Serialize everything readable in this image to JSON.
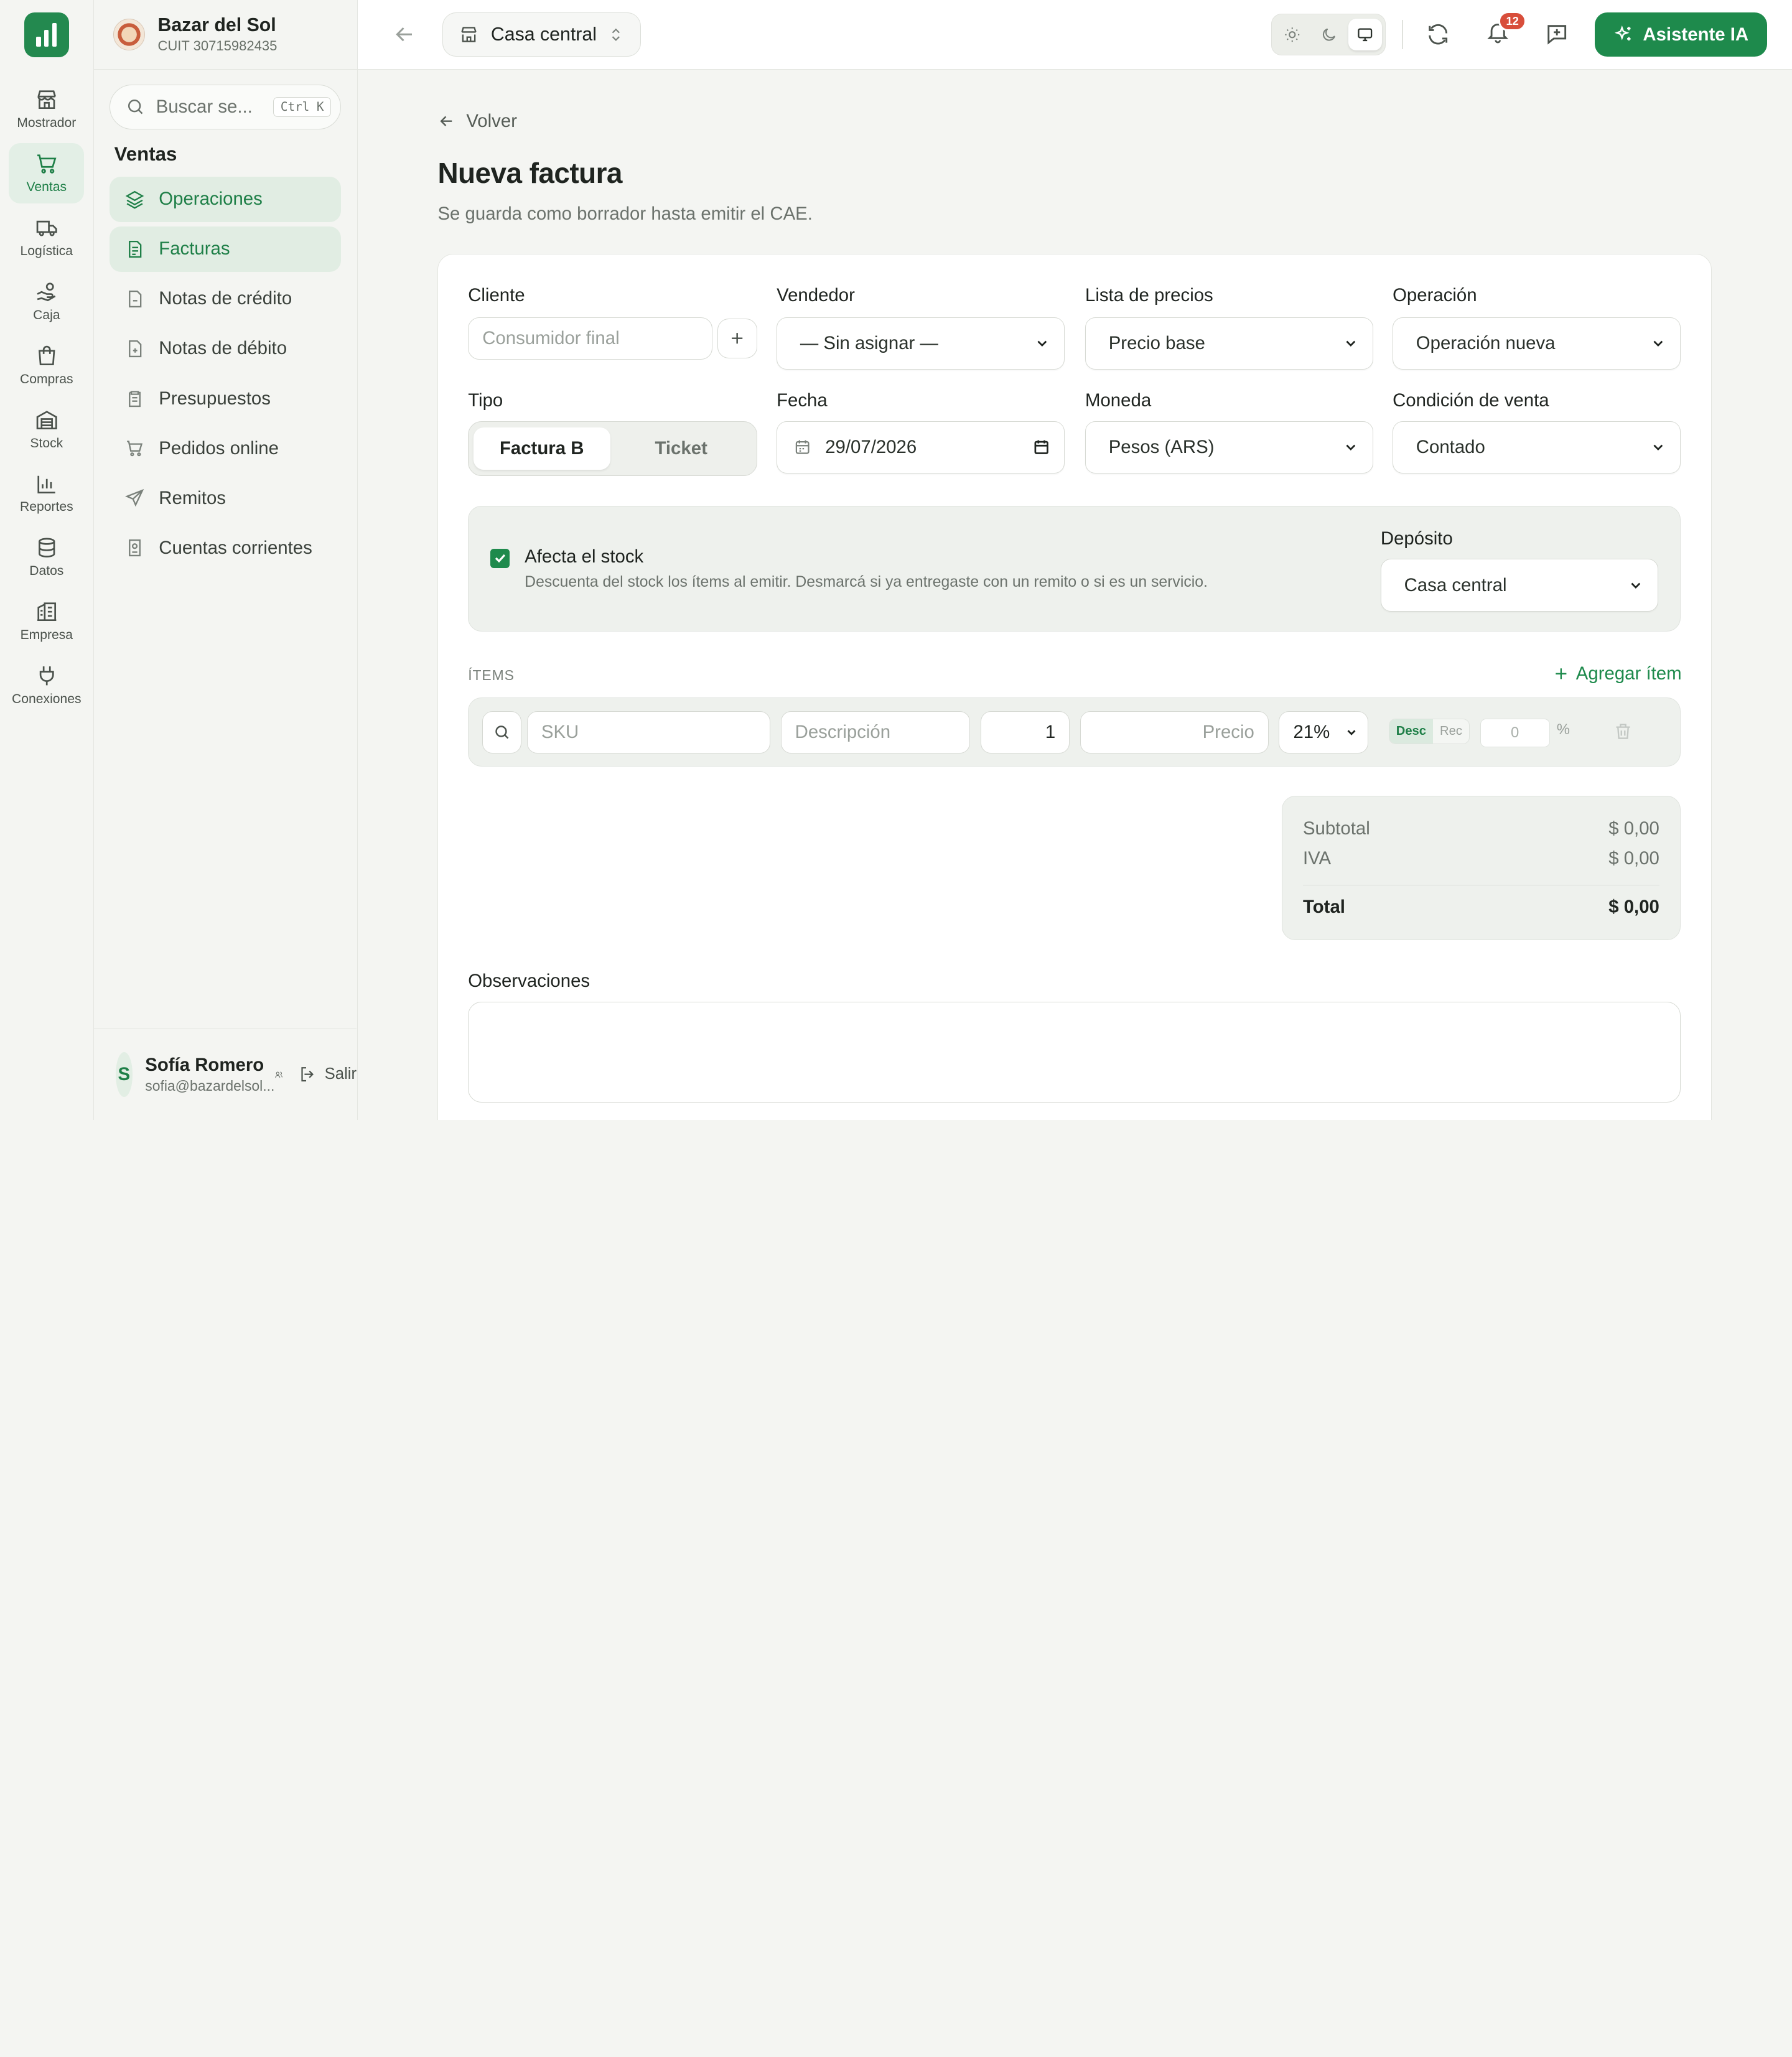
{
  "rail": {
    "items": [
      {
        "label": "Mostrador",
        "icon": "storefront-icon"
      },
      {
        "label": "Ventas",
        "icon": "cart-icon"
      },
      {
        "label": "Logística",
        "icon": "truck-icon"
      },
      {
        "label": "Caja",
        "icon": "cash-hand-icon"
      },
      {
        "label": "Compras",
        "icon": "shopping-bag-icon"
      },
      {
        "label": "Stock",
        "icon": "warehouse-icon"
      },
      {
        "label": "Reportes",
        "icon": "bar-chart-icon"
      },
      {
        "label": "Datos",
        "icon": "database-icon"
      },
      {
        "label": "Empresa",
        "icon": "building-icon"
      },
      {
        "label": "Conexiones",
        "icon": "plug-icon"
      }
    ],
    "active": "Ventas"
  },
  "org": {
    "name": "Bazar del Sol",
    "cuit": "CUIT 30715982435"
  },
  "search": {
    "placeholder": "Buscar se...",
    "shortcut": "Ctrl K"
  },
  "sidebar": {
    "section": "Ventas",
    "items": [
      {
        "label": "Operaciones",
        "icon": "layers-icon"
      },
      {
        "label": "Facturas",
        "icon": "invoice-icon"
      },
      {
        "label": "Notas de crédito",
        "icon": "file-minus-icon"
      },
      {
        "label": "Notas de débito",
        "icon": "file-plus-icon"
      },
      {
        "label": "Presupuestos",
        "icon": "clipboard-icon"
      },
      {
        "label": "Pedidos online",
        "icon": "cart-icon"
      },
      {
        "label": "Remitos",
        "icon": "send-icon"
      },
      {
        "label": "Cuentas corrientes",
        "icon": "account-book-icon"
      }
    ]
  },
  "user": {
    "initial": "S",
    "name": "Sofía Romero",
    "email": "sofia@bazardelsol...",
    "logout": "Salir"
  },
  "topbar": {
    "branch": "Casa central",
    "notifications": "12",
    "ai_button": "Asistente IA"
  },
  "page": {
    "back": "Volver",
    "title": "Nueva factura",
    "subtitle": "Se guarda como borrador hasta emitir el CAE."
  },
  "form": {
    "cliente_label": "Cliente",
    "cliente_placeholder": "Consumidor final",
    "vendedor_label": "Vendedor",
    "vendedor_value": "— Sin asignar —",
    "lista_label": "Lista de precios",
    "lista_value": "Precio base",
    "operacion_label": "Operación",
    "operacion_value": "Operación nueva",
    "tipo_label": "Tipo",
    "tipo_options": [
      "Factura B",
      "Ticket"
    ],
    "fecha_label": "Fecha",
    "fecha_value": "29/07/2026",
    "moneda_label": "Moneda",
    "moneda_value": "Pesos (ARS)",
    "condicion_label": "Condición de venta",
    "condicion_value": "Contado"
  },
  "stock": {
    "checked": true,
    "title": "Afecta el stock",
    "description": "Descuenta del stock los ítems al emitir. Desmarcá si ya entregaste con un remito o si es un servicio.",
    "deposito_label": "Depósito",
    "deposito_value": "Casa central"
  },
  "items": {
    "label": "ÍTEMS",
    "add": "Agregar ítem",
    "sku_placeholder": "SKU",
    "desc_placeholder": "Descripción",
    "qty": "1",
    "price_placeholder": "Precio",
    "iva": "21%",
    "desc_toggle": "Desc",
    "rec_toggle": "Rec",
    "discount": "0",
    "percent": "%"
  },
  "totals": {
    "subtotal_label": "Subtotal",
    "subtotal": "$ 0,00",
    "iva_label": "IVA",
    "iva": "$ 0,00",
    "total_label": "Total",
    "total": "$ 0,00"
  },
  "observaciones": {
    "label": "Observaciones"
  },
  "colors": {
    "accent": "#1e8a4c",
    "accent_bg": "#e1ede3",
    "badge": "#d84e3b"
  }
}
